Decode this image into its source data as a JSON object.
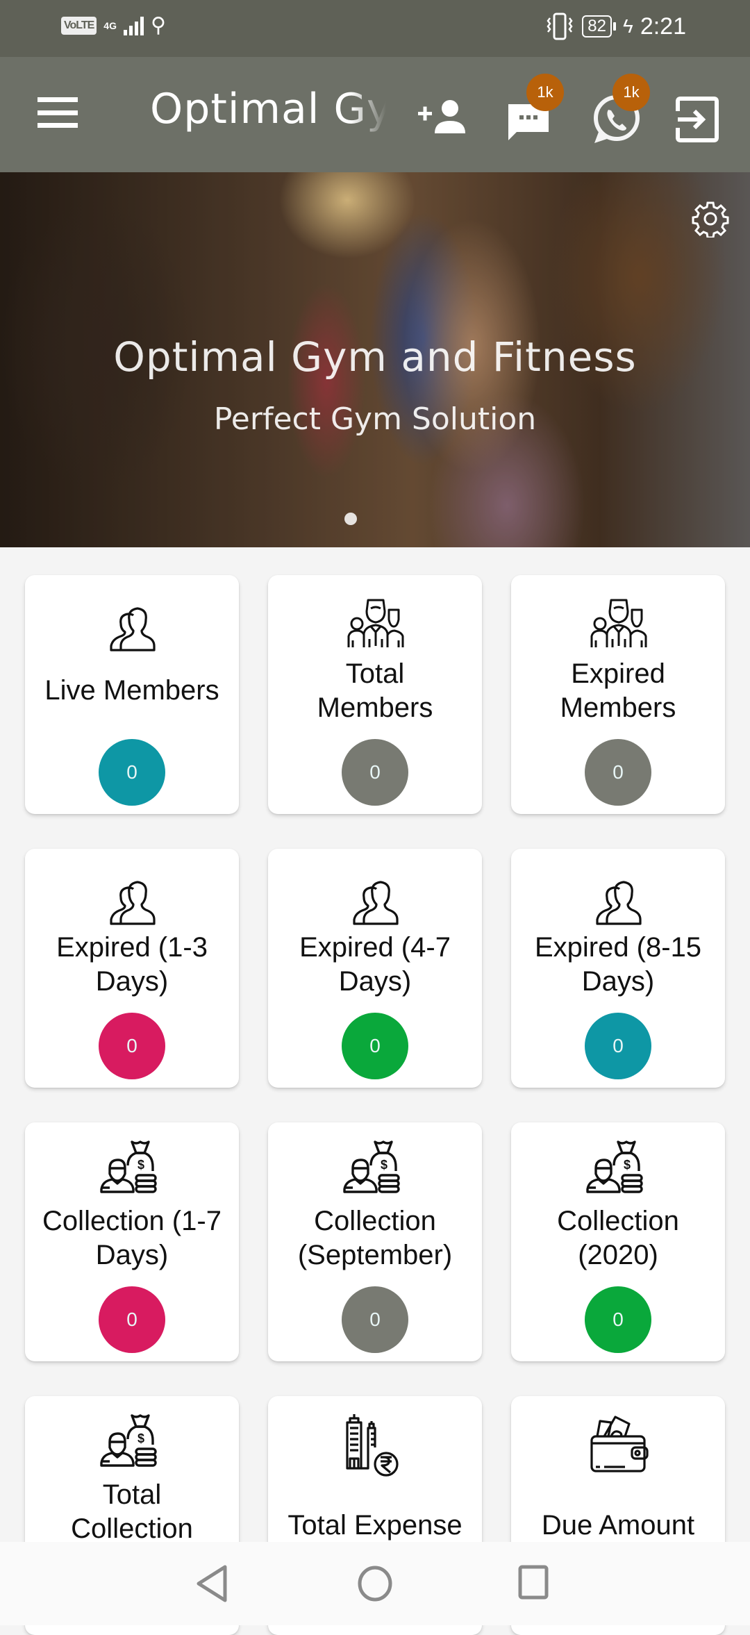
{
  "status_bar": {
    "volte": "VoLTE",
    "network": "4G",
    "battery": "82",
    "time": "2:21"
  },
  "app_bar": {
    "title": "Optimal Gym and Fitness",
    "message_badge": "1k",
    "whatsapp_badge": "1k",
    "icons": [
      "menu-icon",
      "add-person-icon",
      "message-icon",
      "whatsapp-icon",
      "logout-icon"
    ]
  },
  "hero": {
    "title": "Optimal Gym and Fitness",
    "subtitle": "Perfect Gym Solution"
  },
  "colors": {
    "status_bar": "#5f6157",
    "app_bar": "#6d7067",
    "badge": "#b8610a",
    "teal": "#0e97a5",
    "gray": "#787a72",
    "pink": "#d81b60",
    "green": "#0aa83b"
  },
  "cards": [
    {
      "label": "Live Members",
      "count": "0",
      "color": "#0e97a5",
      "icon": "users-icon"
    },
    {
      "label": "Total Members",
      "count": "0",
      "color": "#787a72",
      "icon": "group-icon"
    },
    {
      "label": "Expired Members",
      "count": "0",
      "color": "#787a72",
      "icon": "group-icon"
    },
    {
      "label": "Expired (1-3 Days)",
      "count": "0",
      "color": "#d81b60",
      "icon": "users-icon"
    },
    {
      "label": "Expired (4-7 Days)",
      "count": "0",
      "color": "#0aa83b",
      "icon": "users-icon"
    },
    {
      "label": "Expired (8-15 Days)",
      "count": "0",
      "color": "#0e97a5",
      "icon": "users-icon"
    },
    {
      "label": "Collection (1-7 Days)",
      "count": "0",
      "color": "#d81b60",
      "icon": "money-bag-icon"
    },
    {
      "label": "Collection (September)",
      "count": "0",
      "color": "#787a72",
      "icon": "money-bag-icon"
    },
    {
      "label": "Collection (2020)",
      "count": "0",
      "color": "#0aa83b",
      "icon": "money-bag-icon"
    },
    {
      "label": "Total Collection",
      "count": "",
      "color": "",
      "icon": "money-bag-icon"
    },
    {
      "label": "Total Expense",
      "count": "",
      "color": "",
      "icon": "building-rupee-icon"
    },
    {
      "label": "Due Amount",
      "count": "",
      "color": "",
      "icon": "wallet-icon"
    }
  ]
}
